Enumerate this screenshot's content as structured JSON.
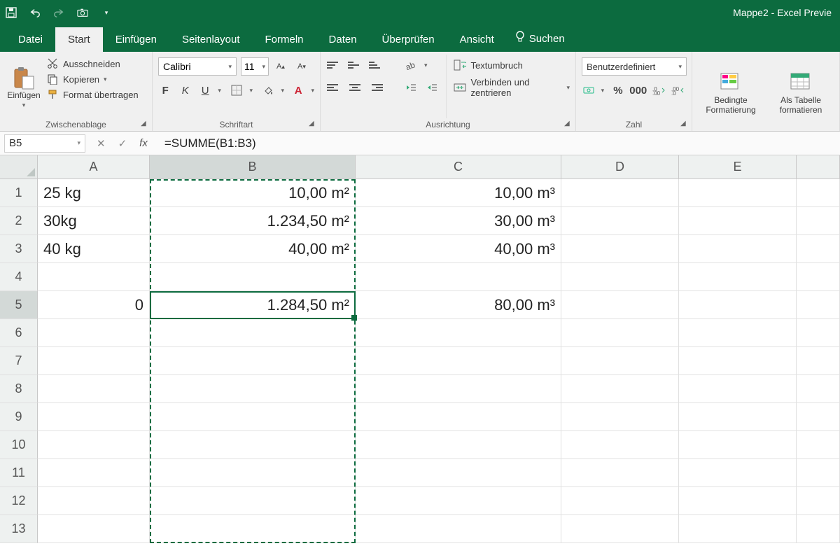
{
  "titlebar": {
    "title": "Mappe2  -  Excel Previe"
  },
  "tabs": {
    "datei": "Datei",
    "start": "Start",
    "einfuegen": "Einfügen",
    "seitenlayout": "Seitenlayout",
    "formeln": "Formeln",
    "daten": "Daten",
    "ueberpruefen": "Überprüfen",
    "ansicht": "Ansicht",
    "suchen": "Suchen"
  },
  "ribbon": {
    "clipboard": {
      "paste": "Einfügen",
      "cut": "Ausschneiden",
      "copy": "Kopieren",
      "formatpainter": "Format übertragen",
      "group": "Zwischenablage"
    },
    "font": {
      "name": "Calibri",
      "size": "11",
      "group": "Schriftart"
    },
    "alignment": {
      "wrap": "Textumbruch",
      "merge": "Verbinden und zentrieren",
      "group": "Ausrichtung"
    },
    "number": {
      "format": "Benutzerdefiniert",
      "group": "Zahl"
    },
    "styles": {
      "conditional": "Bedingte Formatierung",
      "astable": "Als Tabelle formatieren"
    }
  },
  "fxbar": {
    "namebox": "B5",
    "formula": "=SUMME(B1:B3)"
  },
  "columns": {
    "A": "A",
    "B": "B",
    "C": "C",
    "D": "D",
    "E": "E",
    "F": ""
  },
  "rows": [
    "1",
    "2",
    "3",
    "4",
    "5",
    "6",
    "7",
    "8",
    "9",
    "10",
    "11",
    "12",
    "13"
  ],
  "cells": {
    "A1": "25 kg",
    "B1": "10,00 m²",
    "C1": "10,00 m³",
    "A2": "30kg",
    "B2": "1.234,50 m²",
    "C2": "30,00 m³",
    "A3": "40 kg",
    "B3": "40,00 m²",
    "C3": "40,00 m³",
    "A5": "0",
    "B5": "1.284,50 m²",
    "C5": "80,00 m³"
  }
}
